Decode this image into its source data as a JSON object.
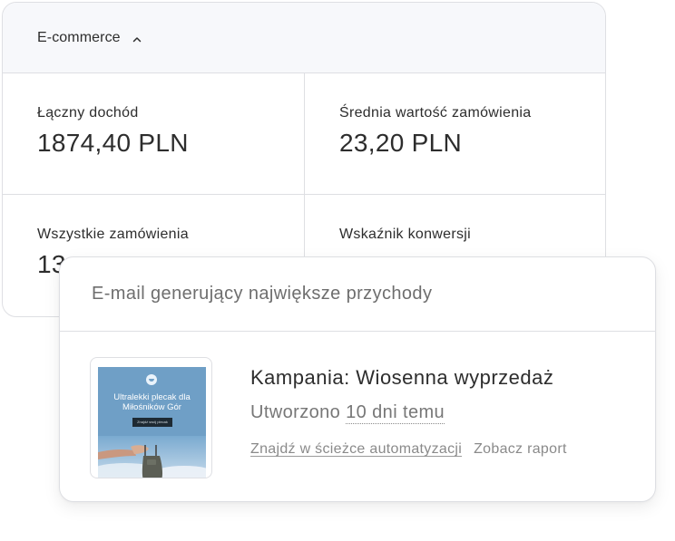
{
  "ecommerce": {
    "title": "E-commerce",
    "collapse_icon": "chevron-up-icon",
    "metrics": [
      {
        "label": "Łączny dochód",
        "value": "1874,40 PLN"
      },
      {
        "label": "Średnia wartość zamówienia",
        "value": "23,20 PLN"
      },
      {
        "label": "Wszystkie zamówienia",
        "value": "13"
      },
      {
        "label": "Wskaźnik konwersji",
        "value": ""
      }
    ]
  },
  "top_email": {
    "title": "E-mail generujący największe przychody",
    "thumbnail": {
      "heading": "Ultralekki plecak dla Miłośników Gór",
      "button": "Znajdź swój plecak",
      "background_color": "#6f9fc6"
    },
    "campaign_title": "Kampania: Wiosenna wyprzedaż",
    "created_prefix": "Utworzono ",
    "created_when": "10 dni temu",
    "link_automation": "Znajdź w ścieżce automatyzacji",
    "link_report": "Zobacz raport"
  }
}
